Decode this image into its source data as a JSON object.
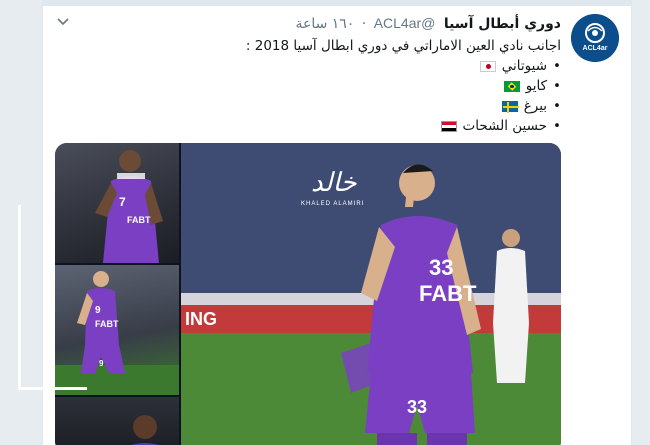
{
  "tweet": {
    "display_name": "دوري أبطال آسيا",
    "handle": "@ACL4ar",
    "time": "١٦٠ ساعة",
    "dot": "·",
    "intro": "اجانب نادي العين الاماراتي في دوري ابطال آسيا 2018 :",
    "players": [
      {
        "name": "شيوتاني",
        "flag": "japan-flag"
      },
      {
        "name": "كايو",
        "flag": "brazil-flag"
      },
      {
        "name": "بيرغ",
        "flag": "sweden-flag"
      },
      {
        "name": "حسين الشحات",
        "flag": "egypt-flag"
      }
    ],
    "bullet": "•"
  },
  "avatar": {
    "label": "ACL4ar"
  },
  "media": {
    "watermark": "KHALED ALAMIRI",
    "main_number": "33",
    "main_sponsor": "FABT",
    "main_number_shorts": "33",
    "thumb1_number": "7",
    "thumb1_sponsor": "FABT",
    "thumb2_number": "9",
    "thumb2_sponsor": "FABT",
    "thumb2_shorts_number": "9",
    "banner_text": "ING"
  },
  "colors": {
    "purple": "#7b3fc4",
    "accent_blue": "#1da1f2",
    "card_bg": "#ffffff",
    "page_bg": "#e6ecf0"
  }
}
